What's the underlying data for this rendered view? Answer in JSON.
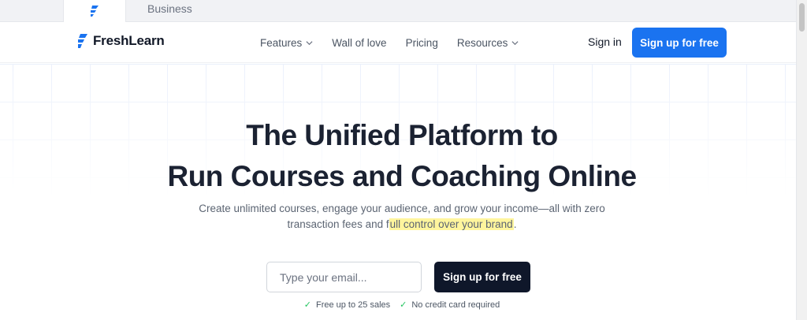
{
  "tabs": {
    "business": "Business"
  },
  "brand": {
    "name": "FreshLearn",
    "color": "#1a73f0"
  },
  "nav": {
    "links": [
      {
        "label": "Features",
        "dropdown": true
      },
      {
        "label": "Wall of love",
        "dropdown": false
      },
      {
        "label": "Pricing",
        "dropdown": false
      },
      {
        "label": "Resources",
        "dropdown": true
      }
    ],
    "signin": "Sign in",
    "signup": "Sign up for free"
  },
  "hero": {
    "title_line1": "The Unified Platform to",
    "title_line2": "Run Courses and Coaching Online",
    "subtitle_line1": "Create unlimited courses, engage your audience, and grow your income—all with zero",
    "subtitle_line2_prefix": "transaction fees and f",
    "subtitle_highlight": "ull control over your brand",
    "subtitle_suffix": ".",
    "email_placeholder": "Type your email...",
    "cta": "Sign up for free",
    "perks": [
      "Free up to 25 sales",
      "No credit card required"
    ]
  },
  "colors": {
    "accent": "#1a73f0",
    "dark_cta": "#0f172a",
    "check": "#22c55e",
    "highlight": "#fff59d"
  }
}
